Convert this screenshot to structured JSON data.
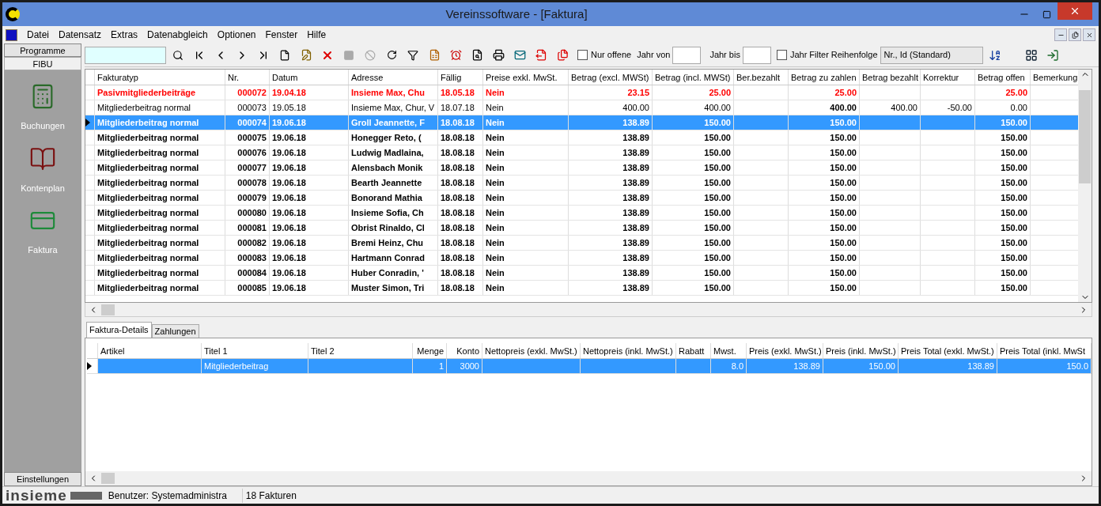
{
  "window": {
    "title": "Vereinssoftware - [Faktura]"
  },
  "menu": [
    "Datei",
    "Datensatz",
    "Extras",
    "Datenabgleich",
    "Optionen",
    "Fenster",
    "Hilfe"
  ],
  "sidebar": {
    "button": "Programme",
    "section": "FIBU",
    "items": [
      {
        "label": "Buchungen",
        "kind": "calculator"
      },
      {
        "label": "Kontenplan",
        "kind": "book"
      },
      {
        "label": "Faktura",
        "kind": "invoice"
      }
    ],
    "footer": "Einstellungen"
  },
  "toolbar": {
    "nur_offene": {
      "label": "Nur offene",
      "checked": false
    },
    "jahr_von": {
      "label": "Jahr von"
    },
    "jahr_bis": {
      "label": "Jahr bis"
    },
    "jahr_filter": {
      "label": "Jahr Filter",
      "checked": false
    },
    "reihenfolge": {
      "label": "Reihenfolge",
      "value": "Nr., Id (Standard)"
    }
  },
  "table": {
    "columns": [
      "Fakturatyp",
      "Nr.",
      "Datum",
      "Adresse",
      "Fällig",
      "Preise exkl. MwSt.",
      "Betrag (excl. MWSt)",
      "Betrag (incl. MWSt)",
      "Ber.bezahlt",
      "Betrag zu zahlen",
      "Betrag bezahlt",
      "Korrektur",
      "Betrag offen",
      "Bemerkung"
    ],
    "rows": [
      {
        "kind": "overdue",
        "selected": false,
        "type": "Pasivmitgliederbeiträge",
        "nr": "000072",
        "datum": "19.04.18",
        "adresse": "Insieme Max, Chu",
        "faellig": "18.05.18",
        "preise": "Nein",
        "excl": "23.15",
        "incl": "25.00",
        "zu_zahlen": "25.00",
        "offen": "25.00"
      },
      {
        "kind": "paid",
        "selected": false,
        "type": "Mitgliederbeitrag normal",
        "nr": "000073",
        "datum": "19.05.18",
        "adresse": "Insieme Max, Chur, V",
        "faellig": "18.07.18",
        "preise": "Nein",
        "excl": "400.00",
        "incl": "400.00",
        "zu_zahlen": "400.00",
        "bezahlt": "400.00",
        "korrektur": "-50.00",
        "offen": "0.00"
      },
      {
        "kind": "open",
        "selected": true,
        "type": "Mitgliederbeitrag normal",
        "nr": "000074",
        "datum": "19.06.18",
        "adresse": "Groll Jeannette, F",
        "faellig": "18.08.18",
        "preise": "Nein",
        "excl": "138.89",
        "incl": "150.00",
        "zu_zahlen": "150.00",
        "offen": "150.00"
      },
      {
        "kind": "open",
        "selected": false,
        "type": "Mitgliederbeitrag normal",
        "nr": "000075",
        "datum": "19.06.18",
        "adresse": "Honegger Reto, (",
        "faellig": "18.08.18",
        "preise": "Nein",
        "excl": "138.89",
        "incl": "150.00",
        "zu_zahlen": "150.00",
        "offen": "150.00"
      },
      {
        "kind": "open",
        "selected": false,
        "type": "Mitgliederbeitrag normal",
        "nr": "000076",
        "datum": "19.06.18",
        "adresse": "Ludwig Madlaina,",
        "faellig": "18.08.18",
        "preise": "Nein",
        "excl": "138.89",
        "incl": "150.00",
        "zu_zahlen": "150.00",
        "offen": "150.00"
      },
      {
        "kind": "open",
        "selected": false,
        "type": "Mitgliederbeitrag normal",
        "nr": "000077",
        "datum": "19.06.18",
        "adresse": "Alensbach Monik",
        "faellig": "18.08.18",
        "preise": "Nein",
        "excl": "138.89",
        "incl": "150.00",
        "zu_zahlen": "150.00",
        "offen": "150.00"
      },
      {
        "kind": "open",
        "selected": false,
        "type": "Mitgliederbeitrag normal",
        "nr": "000078",
        "datum": "19.06.18",
        "adresse": "Bearth Jeannette",
        "faellig": "18.08.18",
        "preise": "Nein",
        "excl": "138.89",
        "incl": "150.00",
        "zu_zahlen": "150.00",
        "offen": "150.00"
      },
      {
        "kind": "open",
        "selected": false,
        "type": "Mitgliederbeitrag normal",
        "nr": "000079",
        "datum": "19.06.18",
        "adresse": "Bonorand Mathia",
        "faellig": "18.08.18",
        "preise": "Nein",
        "excl": "138.89",
        "incl": "150.00",
        "zu_zahlen": "150.00",
        "offen": "150.00"
      },
      {
        "kind": "open",
        "selected": false,
        "type": "Mitgliederbeitrag normal",
        "nr": "000080",
        "datum": "19.06.18",
        "adresse": "Insieme Sofia, Ch",
        "faellig": "18.08.18",
        "preise": "Nein",
        "excl": "138.89",
        "incl": "150.00",
        "zu_zahlen": "150.00",
        "offen": "150.00"
      },
      {
        "kind": "open",
        "selected": false,
        "type": "Mitgliederbeitrag normal",
        "nr": "000081",
        "datum": "19.06.18",
        "adresse": "Obrist Rinaldo, Cl",
        "faellig": "18.08.18",
        "preise": "Nein",
        "excl": "138.89",
        "incl": "150.00",
        "zu_zahlen": "150.00",
        "offen": "150.00"
      },
      {
        "kind": "open",
        "selected": false,
        "type": "Mitgliederbeitrag normal",
        "nr": "000082",
        "datum": "19.06.18",
        "adresse": "Bremi Heinz, Chu",
        "faellig": "18.08.18",
        "preise": "Nein",
        "excl": "138.89",
        "incl": "150.00",
        "zu_zahlen": "150.00",
        "offen": "150.00"
      },
      {
        "kind": "open",
        "selected": false,
        "type": "Mitgliederbeitrag normal",
        "nr": "000083",
        "datum": "19.06.18",
        "adresse": "Hartmann Conrad",
        "faellig": "18.08.18",
        "preise": "Nein",
        "excl": "138.89",
        "incl": "150.00",
        "zu_zahlen": "150.00",
        "offen": "150.00"
      },
      {
        "kind": "open",
        "selected": false,
        "type": "Mitgliederbeitrag normal",
        "nr": "000084",
        "datum": "19.06.18",
        "adresse": "Huber Conradin, '",
        "faellig": "18.08.18",
        "preise": "Nein",
        "excl": "138.89",
        "incl": "150.00",
        "zu_zahlen": "150.00",
        "offen": "150.00"
      },
      {
        "kind": "open",
        "selected": false,
        "type": "Mitgliederbeitrag normal",
        "nr": "000085",
        "datum": "19.06.18",
        "adresse": "Muster Simon, Tri",
        "faellig": "18.08.18",
        "preise": "Nein",
        "excl": "138.89",
        "incl": "150.00",
        "zu_zahlen": "150.00",
        "offen": "150.00"
      }
    ]
  },
  "detail_tabs": [
    {
      "label": "Faktura-Details",
      "selected": true
    },
    {
      "label": "Zahlungen",
      "selected": false
    }
  ],
  "details": {
    "columns": [
      "Artikel",
      "Titel 1",
      "Titel 2",
      "Menge",
      "Konto",
      "Nettopreis (exkl. MwSt.)",
      "Nettopreis (inkl. MwSt.)",
      "Rabatt",
      "Mwst.",
      "Preis (exkl. MwSt.)",
      "Preis (inkl. MwSt.)",
      "Preis Total (exkl. MwSt.)",
      "Preis Total (inkl. MwSt"
    ],
    "rows": [
      {
        "selected": true,
        "titel1": "Mitgliederbeitrag",
        "menge": "1",
        "konto": "3000",
        "mwst": "8.0",
        "preis_excl": "138.89",
        "preis_incl": "150.00",
        "total_excl": "138.89",
        "total_incl": "150.0"
      }
    ]
  },
  "status_bar": {
    "logo": "insieme",
    "user": "Benutzer: Systemadministra",
    "count": "18 Fakturen"
  }
}
